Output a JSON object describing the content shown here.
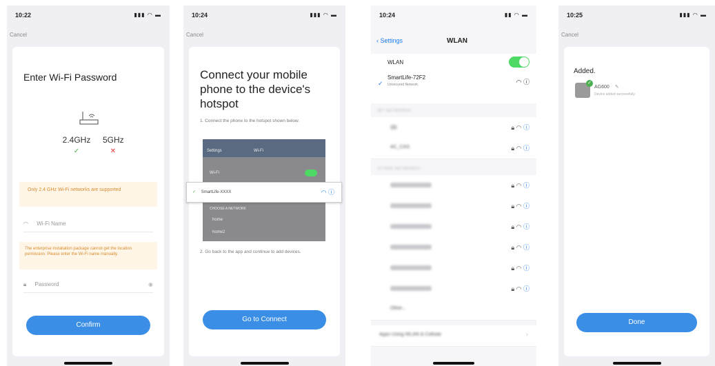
{
  "screens": [
    {
      "time": "10:22",
      "cancel": "Cancel",
      "title": "Enter Wi-Fi Password",
      "band_24": "2.4GHz",
      "band_5": "5GHz",
      "warning_24": "Only 2.4 GHz Wi-Fi networks are supported",
      "wifi_name_placeholder": "Wi-Fi Name",
      "warning_permission": "The enterprise installation package cannot get the location permission. Please enter the Wi-Fi name manually.",
      "password_placeholder": "Password",
      "confirm_button": "Confirm"
    },
    {
      "time": "10:24",
      "cancel": "Cancel",
      "title": "Connect your mobile phone to the device's hotspot",
      "step1": "1. Connect the phone to the hotspot shown below.",
      "shot_back": "Settings",
      "shot_title": "Wi-Fi",
      "shot_wlan": "Wi-Fi",
      "shot_hotspot": "SmartLife-XXXX",
      "shot_choose": "CHOOSE A NETWORK",
      "shot_net1": "home",
      "shot_net2": "home2",
      "step2": "2. Go back to the app and continue to add devices.",
      "go_button": "Go to Connect"
    },
    {
      "time": "10:24",
      "app_back": "Settings",
      "nav_title": "WLAN",
      "wlan_label": "WLAN",
      "connected_ssid": "SmartLife-72F2",
      "connected_sub": "Unsecured Network",
      "section_networks": "MY NETWORKS",
      "section_other": "OTHER NETWORKS",
      "network_2": "AC_CAS",
      "other_label": "Other...",
      "bottom_row": "Apps Using WLAN & Cellular"
    },
    {
      "time": "10:25",
      "cancel": "Cancel",
      "added_title": "Added.",
      "device_name": "AG600",
      "device_status": "Device added successfully",
      "done_button": "Done"
    }
  ],
  "colors": {
    "accent": "#3a8ee6",
    "ios_blue": "#1a7cf0",
    "ok_green": "#4caf50",
    "error_red": "#e53935",
    "warn_bg": "#fff6e8",
    "warn_text": "#d68a2e"
  }
}
